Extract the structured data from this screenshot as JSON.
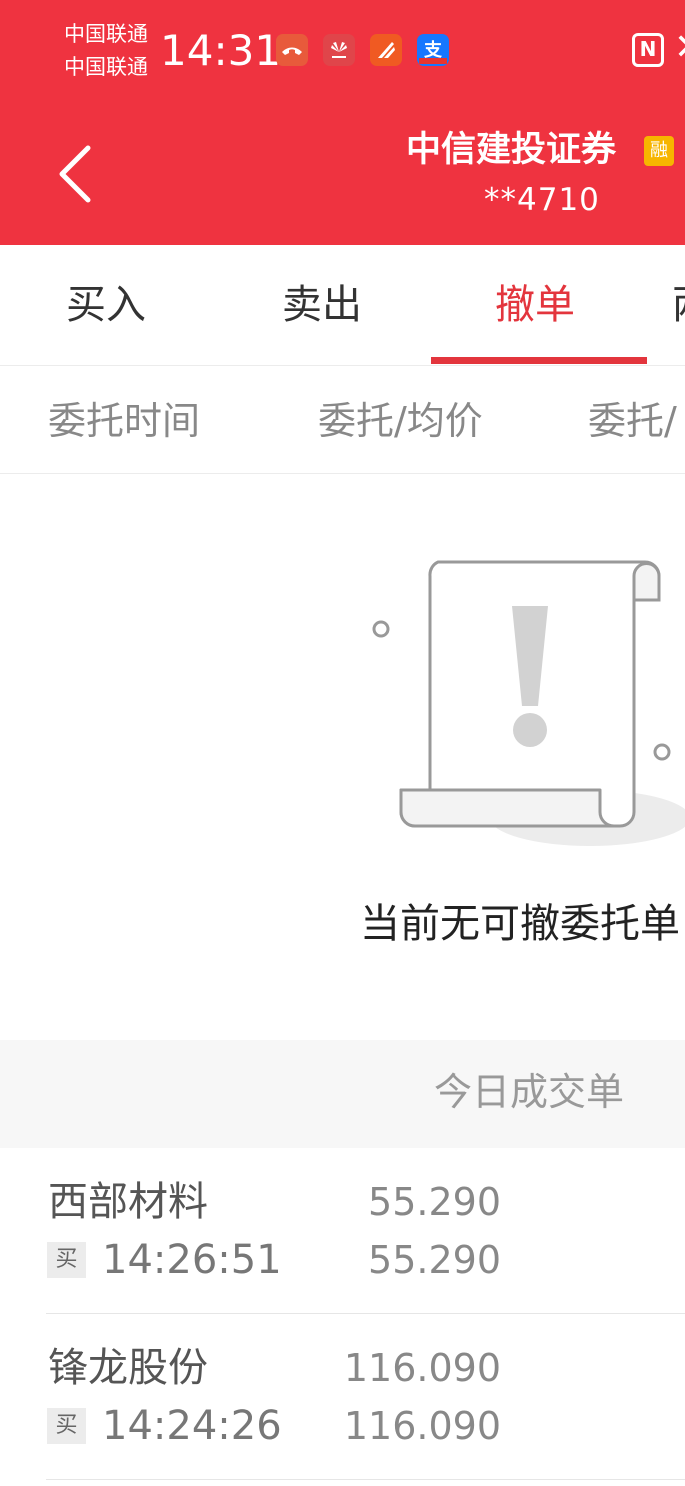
{
  "status_bar": {
    "carrier_1": "中国联通",
    "carrier_2": "中国联通",
    "time": "14:31",
    "notification_icons": [
      "call-icon",
      "huawei-icon",
      "app-icon",
      "alipay-icon"
    ],
    "nfc_label": "N",
    "close_glyph": "✕"
  },
  "header": {
    "broker_name": "中信建投证券",
    "margin_badge": "融",
    "account": "**4710",
    "bg_color": "#ef3340"
  },
  "tabs": [
    {
      "label": "买入",
      "active": false
    },
    {
      "label": "卖出",
      "active": false
    },
    {
      "label": "撤单",
      "active": true
    },
    {
      "label": "两",
      "active": false
    }
  ],
  "columns": [
    "委托时间",
    "委托/均价",
    "委托/"
  ],
  "empty_state": {
    "message": "当前无可撤委托单"
  },
  "today_trades": {
    "header": "今日成交单",
    "rows": [
      {
        "name": "西部材料",
        "side": "买",
        "time": "14:26:51",
        "price_1": "55.290",
        "price_2": "55.290"
      },
      {
        "name": "锋龙股份",
        "side": "买",
        "time": "14:24:26",
        "price_1": "116.090",
        "price_2": "116.090"
      }
    ]
  },
  "accent_color": "#e3353d"
}
